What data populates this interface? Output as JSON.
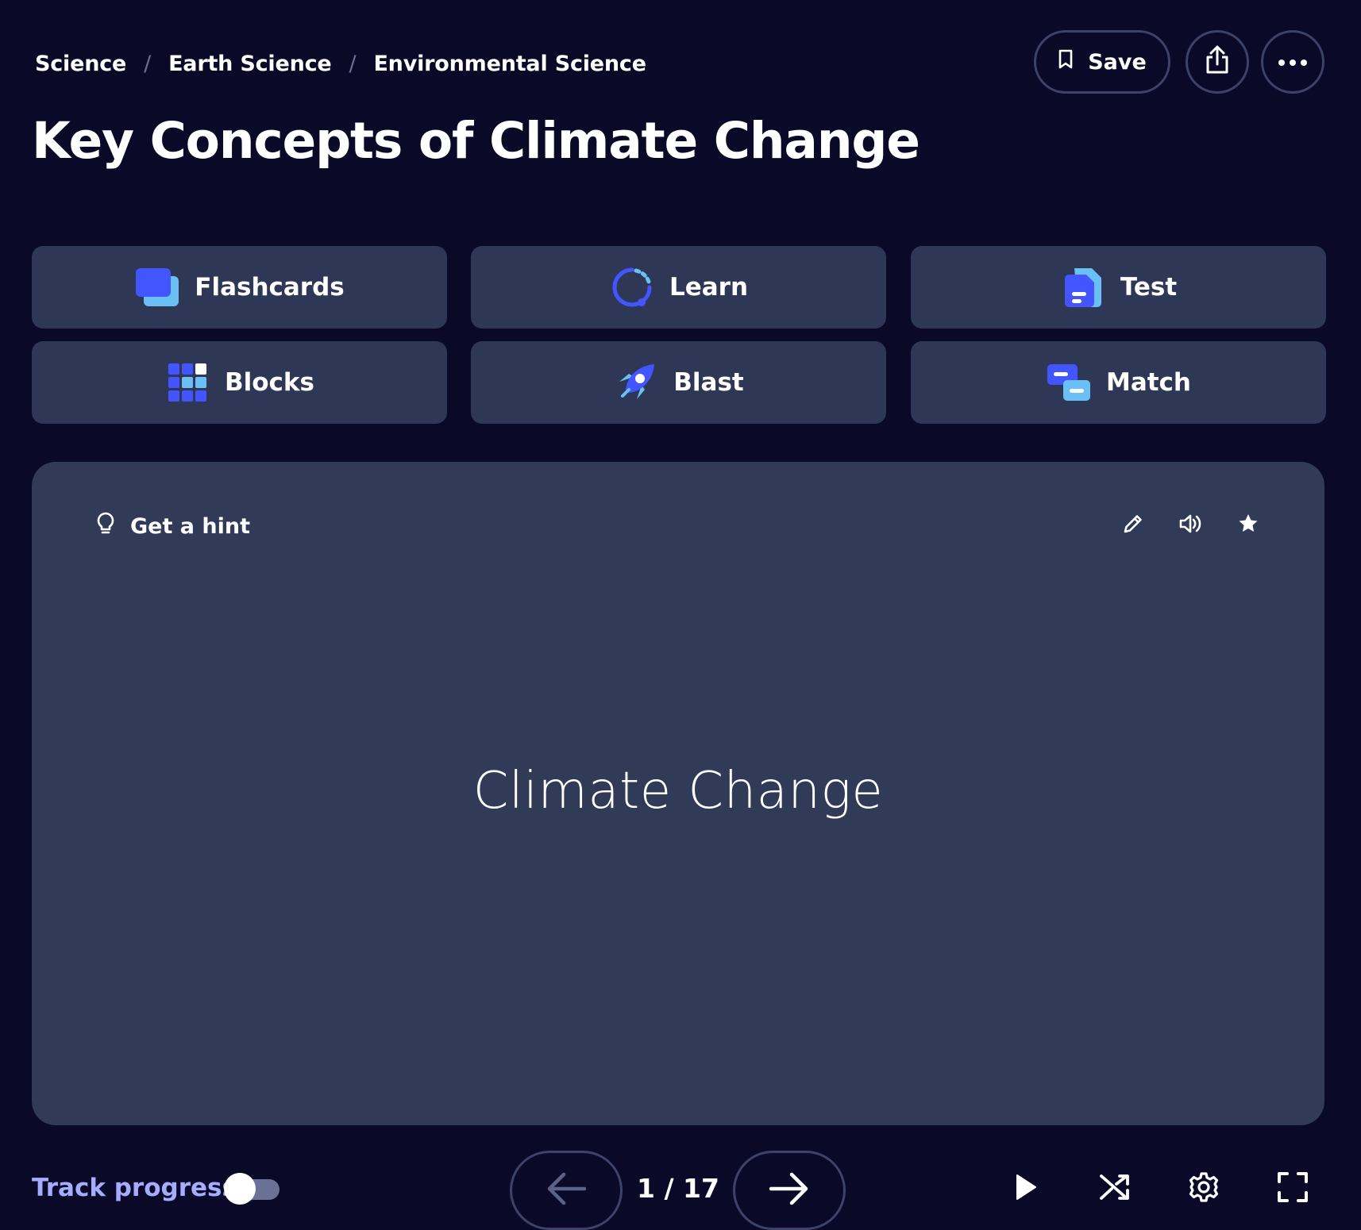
{
  "breadcrumb": [
    "Science",
    "Earth Science",
    "Environmental Science"
  ],
  "breadcrumb_separator": "/",
  "title": "Key Concepts of Climate Change",
  "header_actions": {
    "save_label": "Save",
    "save_icon": "bookmark-icon",
    "share_icon": "share-icon",
    "more_icon": "more-icon"
  },
  "modes": [
    {
      "label": "Flashcards",
      "icon": "flashcards-icon"
    },
    {
      "label": "Learn",
      "icon": "learn-icon"
    },
    {
      "label": "Test",
      "icon": "test-icon"
    },
    {
      "label": "Blocks",
      "icon": "blocks-icon"
    },
    {
      "label": "Blast",
      "icon": "rocket-icon"
    },
    {
      "label": "Match",
      "icon": "match-icon"
    }
  ],
  "card": {
    "hint_label": "Get a hint",
    "term": "Climate Change",
    "icons": [
      "pencil-icon",
      "speaker-icon",
      "star-icon"
    ]
  },
  "footer": {
    "track_progress_label": "Track progress",
    "track_progress_on": false,
    "current": 1,
    "total": 17,
    "counter": "1 / 17"
  },
  "colors": {
    "background": "#0a0a28",
    "tile": "#2f3756",
    "card": "#313a57",
    "accent": "#4255ff",
    "accent_light": "#6ac0f5",
    "link": "#a6adff"
  }
}
